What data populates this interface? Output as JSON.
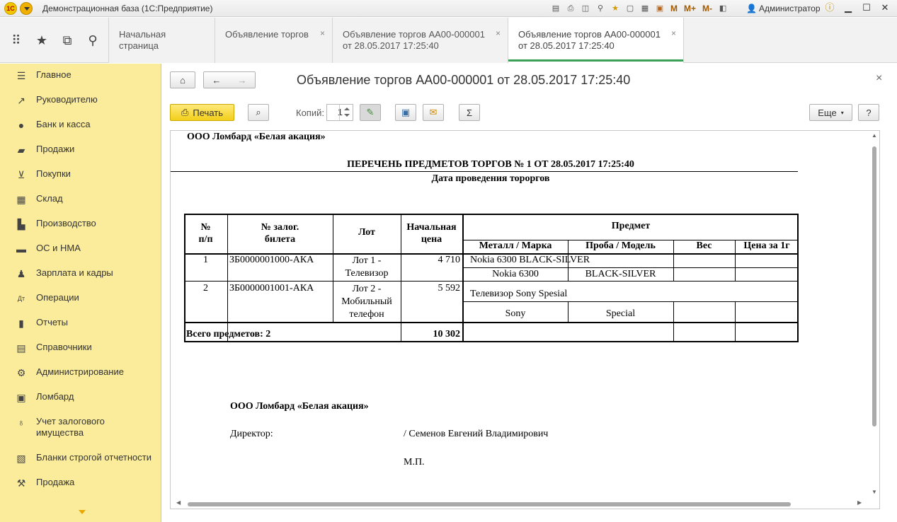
{
  "window": {
    "title": "Демонстрационная база  (1С:Предприятие)",
    "user": "Администратор",
    "m_buttons": [
      "M",
      "M+",
      "M-"
    ]
  },
  "tabs": [
    {
      "label": "Начальная страница",
      "closable": false
    },
    {
      "label": "Объявление торгов",
      "closable": true
    },
    {
      "label": "Объявление торгов АА00-000001 от 28.05.2017 17:25:40",
      "line1": "Объявление торгов АА00-000001",
      "line2": "от 28.05.2017 17:25:40",
      "closable": true
    },
    {
      "label": "Объявление торгов АА00-000001 от 28.05.2017 17:25:40",
      "line1": "Объявление торгов АА00-000001",
      "line2": "от 28.05.2017 17:25:40",
      "closable": true,
      "active": true
    }
  ],
  "sidebar": {
    "items": [
      {
        "label": "Главное",
        "icon": "menu-icon"
      },
      {
        "label": "Руководителю",
        "icon": "trend-icon"
      },
      {
        "label": "Банк и касса",
        "icon": "coin-icon"
      },
      {
        "label": "Продажи",
        "icon": "bag-icon"
      },
      {
        "label": "Покупки",
        "icon": "cart-icon"
      },
      {
        "label": "Склад",
        "icon": "warehouse-icon"
      },
      {
        "label": "Производство",
        "icon": "factory-icon"
      },
      {
        "label": "ОС и НМА",
        "icon": "truck-icon"
      },
      {
        "label": "Зарплата и кадры",
        "icon": "person-icon"
      },
      {
        "label": "Операции",
        "icon": "dt-kt-icon"
      },
      {
        "label": "Отчеты",
        "icon": "bar-chart-icon"
      },
      {
        "label": "Справочники",
        "icon": "book-icon"
      },
      {
        "label": "Администрирование",
        "icon": "gear-icon"
      },
      {
        "label": "Ломбард",
        "icon": "pawnshop-icon"
      },
      {
        "label": "Учет залогового имущества",
        "line1": "Учет залогового",
        "line2": "имущества",
        "icon": "ring-icon"
      },
      {
        "label": "Бланки строгой отчетности",
        "icon": "form-icon"
      },
      {
        "label": "Продажа",
        "icon": "hammer-icon"
      }
    ]
  },
  "form": {
    "title": "Объявление торгов АА00-000001 от 28.05.2017 17:25:40",
    "print_label": "Печать",
    "copies_label": "Копий:",
    "copies_value": "1",
    "more_label": "Еще",
    "help_label": "?"
  },
  "document": {
    "org_name": "ООО Ломбард «Белая акация»",
    "heading": "ПЕРЕЧЕНЬ ПРЕДМЕТОВ ТОРГОВ № 1 ОТ 28.05.2017 17:25:40",
    "subheading": "Дата проведения тороргов",
    "table": {
      "headers": {
        "num": "№\nп/п",
        "num_l1": "№",
        "num_l2": "п/п",
        "ticket_l1": "№ залог.",
        "ticket_l2": "билета",
        "lot": "Лот",
        "price_l1": "Начальная",
        "price_l2": "цена",
        "item": "Предмет",
        "metal": "Металл / Марка",
        "probe": "Проба / Модель",
        "weight": "Вес",
        "price_per_g": "Цена за 1г"
      },
      "rows": [
        {
          "num": "1",
          "ticket": "ЗБ0000001000-АКА",
          "lot_l1": "Лот 1 -",
          "lot_l2": "Телевизор",
          "lot_l3": "",
          "price": "4 710",
          "item_title": "Nokia 6300 BLACK-SILVER",
          "metal": "Nokia 6300",
          "probe": "BLACK-SILVER",
          "weight": "",
          "price_per_g": ""
        },
        {
          "num": "2",
          "ticket": "ЗБ0000001001-АКА",
          "lot_l1": "Лот 2 -",
          "lot_l2": "Мобильный",
          "lot_l3": "телефон",
          "price": "5 592",
          "item_title": "Телевизор Sony Spesial",
          "metal": "Sony",
          "probe": "Special",
          "weight": "",
          "price_per_g": ""
        }
      ],
      "total_label": "Всего предметов: 2",
      "total_price": "10 302"
    },
    "footer": {
      "org_name": "ООО Ломбард «Белая акация»",
      "director_label": "Директор:",
      "director_name": "/ Семенов Евгений Владимирович",
      "stamp": "М.П."
    }
  }
}
